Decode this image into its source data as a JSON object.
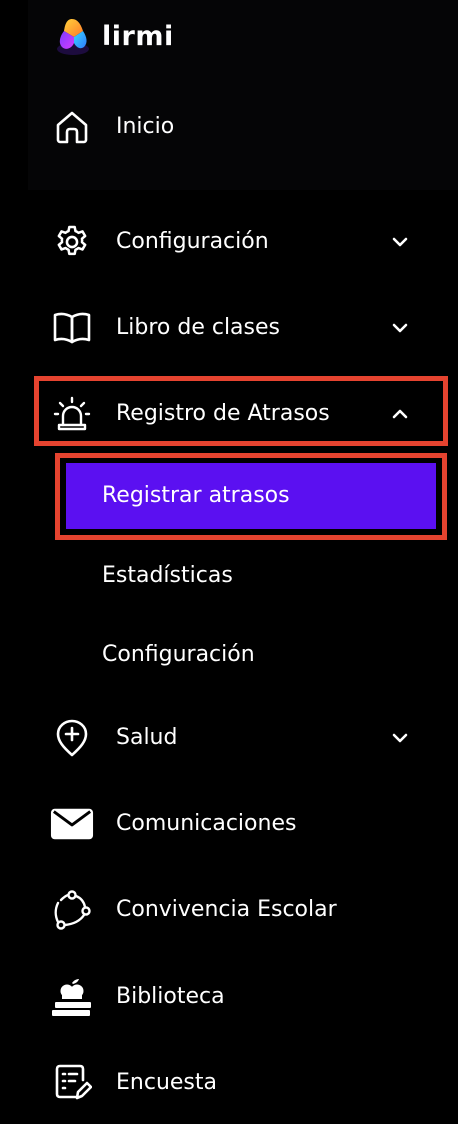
{
  "brand": {
    "name": "lirmi",
    "logo_icon": "lirmi-logo-icon"
  },
  "colors": {
    "background": "#000000",
    "active_bg": "#5b10f1",
    "highlight_border": "#e5432f",
    "text": "#ffffff"
  },
  "nav": {
    "inicio": {
      "label": "Inicio",
      "icon": "home-icon"
    },
    "configuracion": {
      "label": "Configuración",
      "icon": "gear-icon",
      "chevron": "chevron-down-icon"
    },
    "libro": {
      "label": "Libro de clases",
      "icon": "book-icon",
      "chevron": "chevron-down-icon"
    },
    "registro": {
      "label": "Registro de Atrasos",
      "icon": "siren-icon",
      "chevron": "chevron-up-icon",
      "expanded": true,
      "children": [
        {
          "label": "Registrar atrasos",
          "active": true
        },
        {
          "label": "Estadísticas",
          "active": false
        },
        {
          "label": "Configuración",
          "active": false
        }
      ]
    },
    "salud": {
      "label": "Salud",
      "icon": "health-pin-icon",
      "chevron": "chevron-down-icon"
    },
    "comunicaciones": {
      "label": "Comunicaciones",
      "icon": "envelope-icon"
    },
    "convivencia": {
      "label": "Convivencia Escolar",
      "icon": "network-icon"
    },
    "biblioteca": {
      "label": "Biblioteca",
      "icon": "books-apple-icon"
    },
    "encuesta": {
      "label": "Encuesta",
      "icon": "survey-icon"
    }
  }
}
